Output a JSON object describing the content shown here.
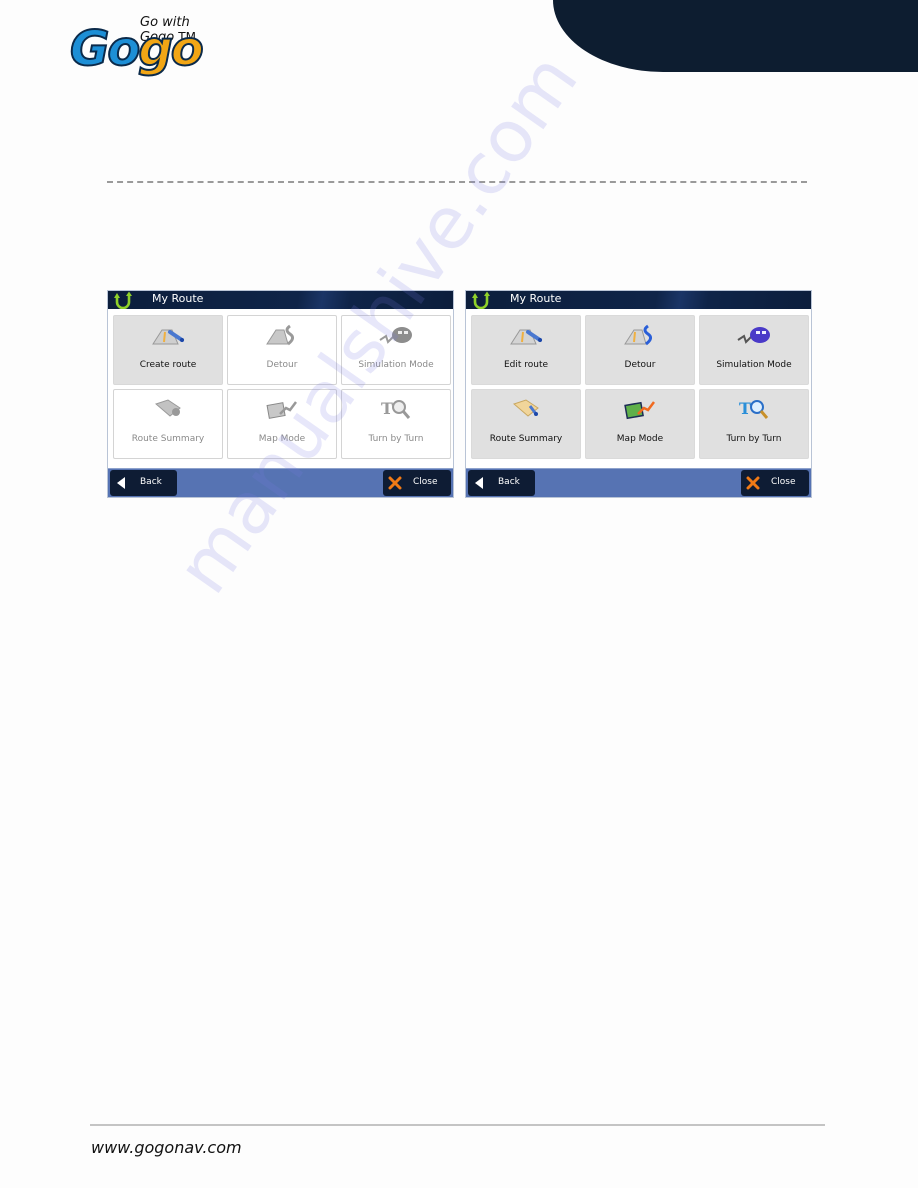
{
  "header": {
    "logo": {
      "tagline": "Go with Gogo",
      "trademark": "TM",
      "wordmark_part1": "Go",
      "wordmark_part2": "go"
    }
  },
  "panels": [
    {
      "title": "My Route",
      "title_icon": "u-turn-icon",
      "tiles": [
        {
          "label": "Create route",
          "icon": "create-route-icon",
          "state": "selected"
        },
        {
          "label": "Detour",
          "icon": "detour-icon",
          "state": "disabled"
        },
        {
          "label": "Simulation Mode",
          "icon": "simulation-car-icon",
          "state": "disabled"
        },
        {
          "label": "Route Summary",
          "icon": "route-summary-icon",
          "state": "disabled"
        },
        {
          "label": "Map Mode",
          "icon": "map-mode-icon",
          "state": "disabled"
        },
        {
          "label": "Turn by Turn",
          "icon": "turn-by-turn-icon",
          "state": "disabled"
        }
      ],
      "back_label": "Back",
      "close_label": "Close"
    },
    {
      "title": "My Route",
      "title_icon": "u-turn-icon",
      "tiles": [
        {
          "label": "Edit route",
          "icon": "edit-route-icon",
          "state": "enabled"
        },
        {
          "label": "Detour",
          "icon": "detour-icon",
          "state": "enabled"
        },
        {
          "label": "Simulation Mode",
          "icon": "simulation-car-icon",
          "state": "enabled"
        },
        {
          "label": "Route Summary",
          "icon": "route-summary-icon",
          "state": "enabled"
        },
        {
          "label": "Map Mode",
          "icon": "map-mode-icon",
          "state": "enabled"
        },
        {
          "label": "Turn by Turn",
          "icon": "turn-by-turn-icon",
          "state": "enabled"
        }
      ],
      "back_label": "Back",
      "close_label": "Close"
    }
  ],
  "colors": {
    "header_dark": "#0d1d30",
    "panel_header": "#0c1e3c",
    "footer_bar": "#5673b3",
    "button_bg": "#0e1c34",
    "uturn_green": "#8fd12a",
    "close_x_orange": "#f07a16"
  },
  "watermark": "manualshive.com",
  "footer": {
    "url": "www.gogonav.com"
  }
}
